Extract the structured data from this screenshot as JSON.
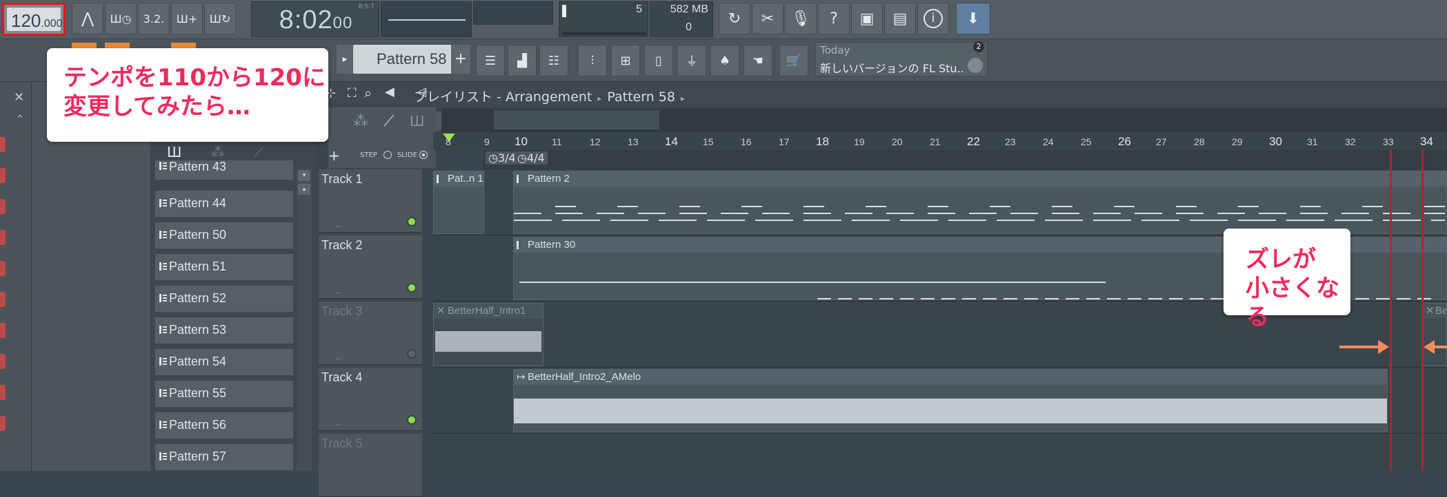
{
  "toolbar": {
    "tempo_main": "120",
    "tempo_frac": ".000",
    "time_display": "8:02",
    "time_small": "00",
    "time_mode": "B:S:T",
    "cpu_value": "5",
    "memory": "582 MB",
    "polyphony": "0",
    "tool_icons": [
      "metronome-icon",
      "wait-icon",
      "countdown-icon",
      "step-edit-icon",
      "loop-record-icon"
    ],
    "right_icons": [
      "undo-icon",
      "cut-icon",
      "mic-icon",
      "help-icon",
      "save-icon",
      "save-alt-icon",
      "info-icon",
      "download-icon"
    ],
    "help_glyph": "?",
    "info_glyph": "i"
  },
  "toolbar2": {
    "pattern_name": "Pattern 58",
    "add_glyph": "+",
    "news_today": "Today",
    "news_text": "新しいバージョンの FL Stu..",
    "news_count": "2"
  },
  "playlist": {
    "title": "プレイリスト - Arrangement",
    "title_pattern": "Pattern 58",
    "step_label": "STEP",
    "slide_label": "SLIDE",
    "add_glyph": "+"
  },
  "browser": {
    "patterns": [
      "Pattern 43",
      "Pattern 44",
      "Pattern 50",
      "Pattern 51",
      "Pattern 52",
      "Pattern 53",
      "Pattern 54",
      "Pattern 55",
      "Pattern 56",
      "Pattern 57"
    ]
  },
  "ruler": {
    "bars": [
      "8",
      "9",
      "10",
      "11",
      "12",
      "13",
      "14",
      "15",
      "16",
      "17",
      "18",
      "19",
      "20",
      "21",
      "22",
      "23",
      "24",
      "25",
      "26",
      "27",
      "28",
      "29",
      "30",
      "31",
      "32",
      "33",
      "34"
    ],
    "time_sig_1": "3/4",
    "time_sig_2": "4/4"
  },
  "tracks": [
    {
      "name": "Track 1",
      "dots": "...",
      "active": true
    },
    {
      "name": "Track 2",
      "dots": "...",
      "active": true
    },
    {
      "name": "Track 3",
      "dots": "...",
      "active": false
    },
    {
      "name": "Track 4",
      "dots": "...",
      "active": true
    },
    {
      "name": "Track 5",
      "dots": "",
      "active": false
    }
  ],
  "clips": {
    "t1_short": "Pat..n 1",
    "t1_main": "Pattern 2",
    "t2_main": "Pattern 30",
    "t3_audio": "BetterHalf_Intro1",
    "t3_right": "Be",
    "t4_audio": "BetterHalf_Intro2_AMelo"
  },
  "annotations": {
    "note1_line1": "テンポを110から120に",
    "note1_line2": "変更してみたら…",
    "note2_line1": "ズレが",
    "note2_line2": "小さくなる"
  },
  "colors": {
    "highlight_red": "#e01818",
    "callout_text": "#ef2a5c",
    "arrow": "#f08c5c",
    "marker": "#a32c2c",
    "led_on": "#8ce04e"
  }
}
